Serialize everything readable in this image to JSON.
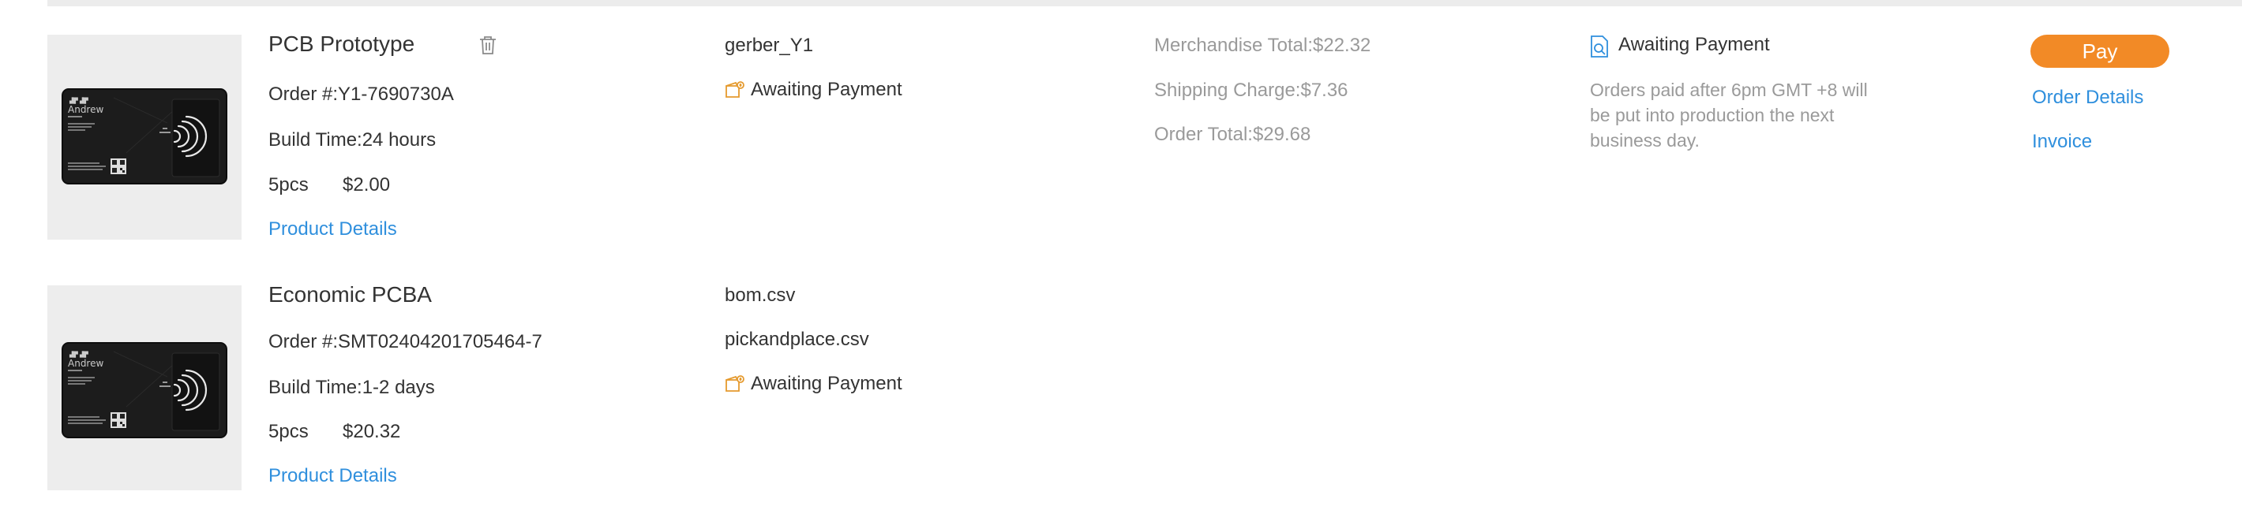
{
  "orders": [
    {
      "product": "PCB Prototype",
      "order_no": "Order #:Y1-7690730A",
      "build_time": "Build Time:24 hours",
      "qty": "5pcs",
      "price": "$2.00",
      "details_link": "Product Details",
      "files": [
        "gerber_Y1"
      ],
      "status": "Awaiting Payment",
      "merchandise_total": "Merchandise Total:$22.32",
      "shipping_charge": "Shipping Charge:$7.36",
      "order_total": "Order Total:$29.68",
      "payment_status": "Awaiting Payment",
      "payment_note": "Orders paid after 6pm GMT +8 will be put into production the next business day.",
      "pay_label": "Pay",
      "order_details_link": "Order Details",
      "invoice_link": "Invoice"
    },
    {
      "product": "Economic PCBA",
      "order_no": "Order #:SMT02404201705464-7",
      "build_time": "Build Time:1-2 days",
      "qty": "5pcs",
      "price": "$20.32",
      "details_link": "Product Details",
      "files": [
        "bom.csv",
        "pickandplace.csv"
      ],
      "status": "Awaiting Payment"
    }
  ],
  "card_image": {
    "text": "Andrew",
    "icons": [
      "nfc-icon",
      "qr-code-icon"
    ]
  },
  "icons": {
    "delete": "trash-icon",
    "status": "wallet-icon",
    "payment": "payment-document-icon"
  },
  "colors": {
    "accent": "#2f8fdd",
    "pay_button": "#f28a26",
    "status_icon": "#f2a63a"
  }
}
